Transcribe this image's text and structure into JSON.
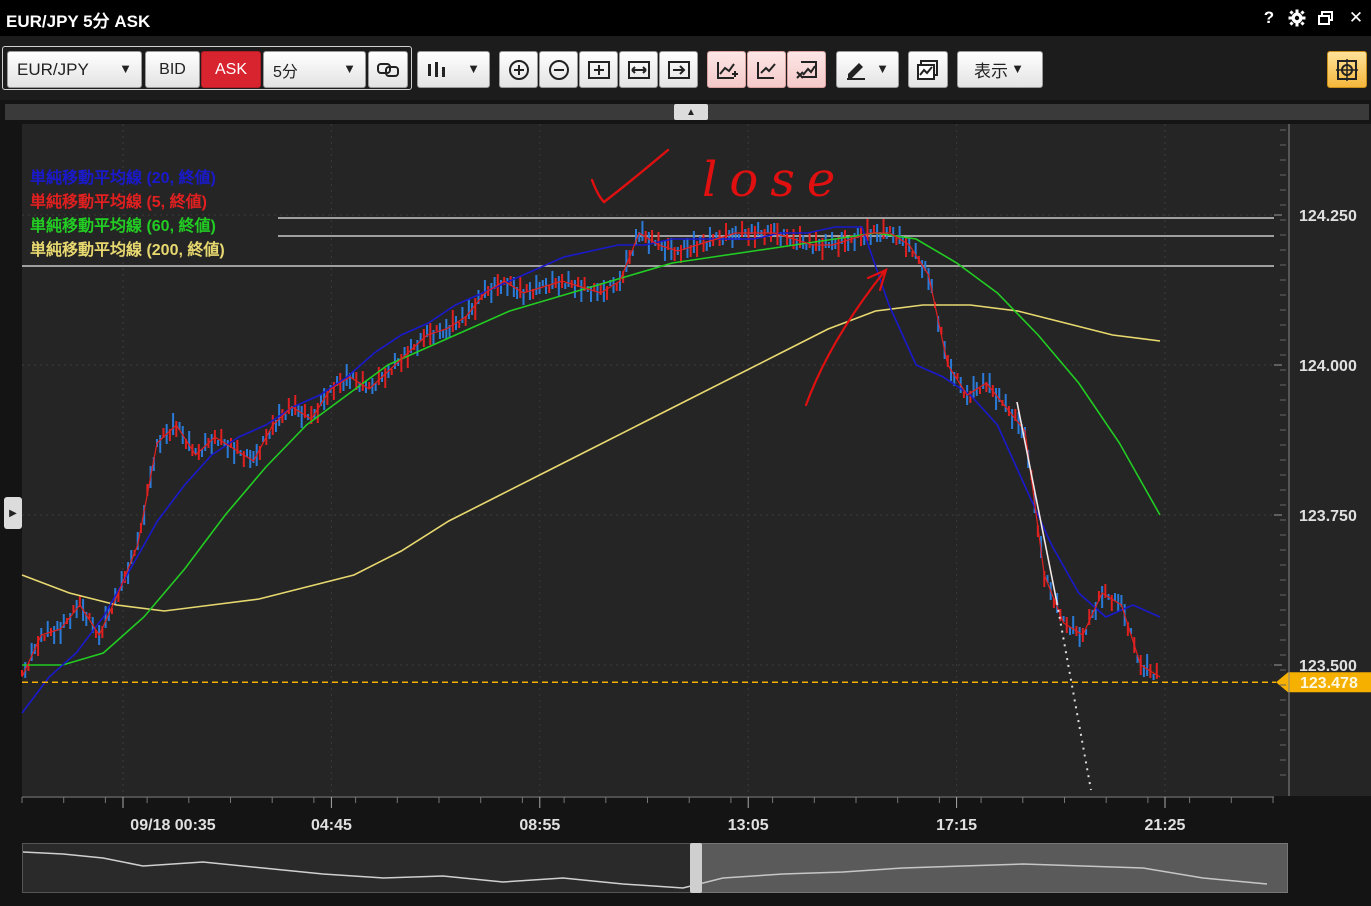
{
  "window": {
    "title": "EUR/JPY 5分 ASK",
    "help_label": "?",
    "settings_icon": "gear-icon",
    "restore_icon": "restore-window-icon",
    "close_label": "✕"
  },
  "toolbar": {
    "symbol": "EUR/JPY",
    "bid_label": "BID",
    "ask_label": "ASK",
    "timeframe": "5分",
    "display_label": "表示",
    "ask_color": "#d8242f"
  },
  "legend": {
    "items": [
      {
        "label": "単純移動平均線 (20, 終値)",
        "color": "#1a1acc"
      },
      {
        "label": "単純移動平均線 (5, 終値)",
        "color": "#e02020"
      },
      {
        "label": "単純移動平均線 (60, 終値)",
        "color": "#22cc22"
      },
      {
        "label": "単純移動平均線 (200, 終値)",
        "color": "#e8d870"
      }
    ]
  },
  "annotation": {
    "handwritten_text": "lose",
    "color": "#e01010"
  },
  "chart_data": {
    "type": "line",
    "title": "",
    "ylim": [
      123.3,
      124.4
    ],
    "yticks": [
      {
        "value": 124.25,
        "label": "124.250"
      },
      {
        "value": 124.0,
        "label": "124.000"
      },
      {
        "value": 123.75,
        "label": "123.750"
      },
      {
        "value": 123.5,
        "label": "123.500"
      }
    ],
    "xticks": [
      "09/18 00:35",
      "04:45",
      "08:55",
      "13:05",
      "17:15",
      "21:25"
    ],
    "current_price": {
      "value": 123.478,
      "label": "123.478",
      "color": "#f5b000"
    },
    "horizontal_lines": [
      124.245,
      124.215,
      124.165
    ],
    "series": [
      {
        "name": "単純移動平均線 (5, 終値)",
        "color": "#e02020",
        "values": [
          123.48,
          123.55,
          123.56,
          123.6,
          123.55,
          123.62,
          123.7,
          123.87,
          123.9,
          123.85,
          123.88,
          123.86,
          123.84,
          123.9,
          123.93,
          123.91,
          123.96,
          123.98,
          123.96,
          123.99,
          124.02,
          124.05,
          124.06,
          124.08,
          124.12,
          124.14,
          124.12,
          124.13,
          124.14,
          124.13,
          124.12,
          124.14,
          124.22,
          124.2,
          124.19,
          124.2,
          124.21,
          124.22,
          124.22,
          124.22,
          124.21,
          124.2,
          124.2,
          124.21,
          124.22,
          124.22,
          124.2,
          124.15,
          124.0,
          123.95,
          123.97,
          123.93,
          123.89,
          123.65,
          123.57,
          123.55,
          123.62,
          123.6,
          123.5,
          123.48
        ]
      },
      {
        "name": "単純移動平均線 (20, 終値)",
        "color": "#1a1acc",
        "values": [
          123.42,
          123.48,
          123.52,
          123.58,
          123.66,
          123.74,
          123.8,
          123.85,
          123.88,
          123.9,
          123.93,
          123.95,
          123.98,
          124.02,
          124.05,
          124.07,
          124.1,
          124.12,
          124.14,
          124.16,
          124.18,
          124.19,
          124.2,
          124.2,
          124.21,
          124.21,
          124.21,
          124.21,
          124.22,
          124.22,
          124.23,
          124.23,
          124.1,
          124.0,
          123.98,
          123.95,
          123.9,
          123.8,
          123.7,
          123.62,
          123.58,
          123.6,
          123.58
        ]
      },
      {
        "name": "単純移動平均線 (60, 終値)",
        "color": "#22cc22",
        "values": [
          123.5,
          123.5,
          123.52,
          123.58,
          123.66,
          123.75,
          123.83,
          123.9,
          123.95,
          124.0,
          124.03,
          124.06,
          124.09,
          124.11,
          124.13,
          124.15,
          124.17,
          124.18,
          124.19,
          124.2,
          124.21,
          124.22,
          124.21,
          124.17,
          124.12,
          124.05,
          123.97,
          123.87,
          123.75
        ]
      },
      {
        "name": "単純移動平均線 (200, 終値)",
        "color": "#e8d870",
        "values": [
          123.65,
          123.62,
          123.6,
          123.59,
          123.6,
          123.61,
          123.63,
          123.65,
          123.69,
          123.74,
          123.78,
          123.82,
          123.86,
          123.9,
          123.94,
          123.98,
          124.02,
          124.06,
          124.09,
          124.1,
          124.1,
          124.09,
          124.07,
          124.05,
          124.04
        ]
      }
    ]
  }
}
